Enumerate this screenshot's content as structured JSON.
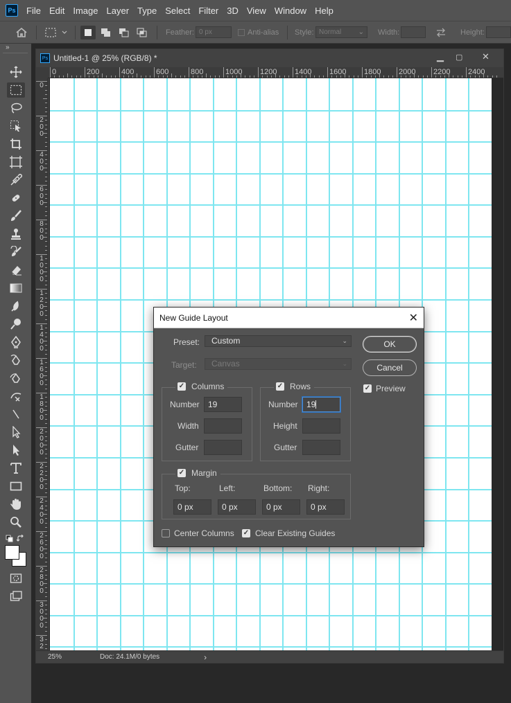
{
  "app": {
    "logo": "Ps",
    "menu": [
      "File",
      "Edit",
      "Image",
      "Layer",
      "Type",
      "Select",
      "Filter",
      "3D",
      "View",
      "Window",
      "Help"
    ]
  },
  "options_bar": {
    "feather_label": "Feather:",
    "feather_value": "0 px",
    "anti_alias_label": "Anti-alias",
    "style_label": "Style:",
    "style_value": "Normal",
    "width_label": "Width:",
    "height_label": "Height:"
  },
  "tools_panel": {
    "collapse": "»",
    "tools": [
      "move-icon",
      "rectangular-marquee-icon",
      "lasso-icon",
      "object-selection-icon",
      "crop-icon",
      "frame-icon",
      "eyedropper-icon",
      "healing-brush-icon",
      "brush-icon",
      "clone-stamp-icon",
      "history-brush-icon",
      "eraser-icon",
      "gradient-icon",
      "blur-icon",
      "dodge-icon",
      "pen-icon",
      "type-icon",
      "path-selection-icon",
      "rectangle-icon",
      "hand-icon",
      "zoom-icon"
    ],
    "foreground_color": "#ffffff",
    "background_color": "#ffffff"
  },
  "document": {
    "tab_icon": "Ps",
    "title": "Untitled-1 @ 25% (RGB/8) *",
    "ruler_h_labels": [
      "0",
      "200",
      "400",
      "600",
      "800",
      "1000",
      "1200",
      "1400",
      "1600",
      "1800",
      "2000",
      "2200",
      "2400"
    ],
    "ruler_v_labels": [
      "0",
      "200",
      "400",
      "600",
      "800",
      "1000",
      "1200",
      "1400",
      "1600",
      "1800",
      "2000",
      "2200",
      "2400",
      "2600",
      "2800",
      "3000",
      "32"
    ],
    "guide_color": "#7ee6f0",
    "zoom": "25%",
    "doc_info": "Doc: 24.1M/0 bytes"
  },
  "dialog": {
    "title": "New Guide Layout",
    "preset_label": "Preset:",
    "preset_value": "Custom",
    "target_label": "Target:",
    "target_value": "Canvas",
    "ok_label": "OK",
    "cancel_label": "Cancel",
    "preview_label": "Preview",
    "preview_checked": true,
    "columns": {
      "label": "Columns",
      "checked": true,
      "number_label": "Number",
      "number_value": "19",
      "width_label": "Width",
      "width_value": "",
      "gutter_label": "Gutter",
      "gutter_value": ""
    },
    "rows": {
      "label": "Rows",
      "checked": true,
      "number_label": "Number",
      "number_value": "19",
      "height_label": "Height",
      "height_value": "",
      "gutter_label": "Gutter",
      "gutter_value": ""
    },
    "margin": {
      "label": "Margin",
      "checked": true,
      "top_label": "Top:",
      "left_label": "Left:",
      "bottom_label": "Bottom:",
      "right_label": "Right:",
      "top_value": "0 px",
      "left_value": "0 px",
      "bottom_value": "0 px",
      "right_value": "0 px"
    },
    "center_columns_label": "Center Columns",
    "center_columns_checked": false,
    "clear_guides_label": "Clear Existing Guides",
    "clear_guides_checked": true
  }
}
